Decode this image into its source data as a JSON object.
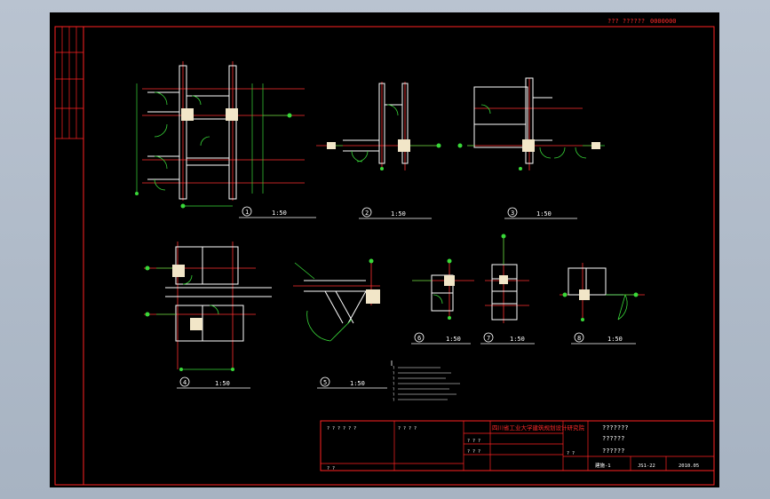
{
  "header": {
    "code_left": "??? ??????",
    "code_right": "0000000"
  },
  "views": [
    {
      "num": "1",
      "scale": "1:50"
    },
    {
      "num": "2",
      "scale": "1:50"
    },
    {
      "num": "3",
      "scale": "1:50"
    },
    {
      "num": "4",
      "scale": "1:50"
    },
    {
      "num": "5",
      "scale": "1:50"
    },
    {
      "num": "6",
      "scale": "1:50"
    },
    {
      "num": "7",
      "scale": "1:50"
    },
    {
      "num": "8",
      "scale": "1:50"
    }
  ],
  "title_block": {
    "project_name": "四川省工业大学建筑规划设计研究院",
    "title_line1": "???????",
    "title_line2": "??????",
    "title_line3": "??????",
    "sheet_code": "建施-1",
    "sheet_no": "JS1-22",
    "date": "2010.05",
    "sign_cells": [
      "? ? ? ? ? ?",
      "? ? ? ?",
      "? ? ?",
      "? ? ?",
      "? ?",
      "? ?"
    ]
  },
  "notes": [
    "?",
    "?",
    "?",
    "?",
    "?",
    "?",
    "?"
  ],
  "colors": {
    "frame": "#ff2222",
    "wall": "#ffffff",
    "dim": "#39d839",
    "axis": "#ff3030",
    "fill_column": "#f2e6c8"
  }
}
